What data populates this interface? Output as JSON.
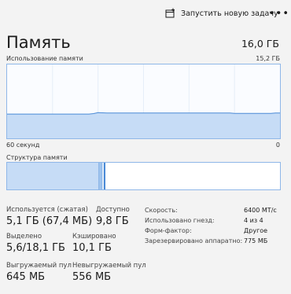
{
  "toolbar": {
    "run_task_label": "Запустить новую задачу",
    "more_label": "•••"
  },
  "header": {
    "title": "Память",
    "total": "16,0 ГБ"
  },
  "usage_chart": {
    "label": "Использование памяти",
    "max_label": "15,2 ГБ",
    "time_label": "60 секунд",
    "zero_label": "0"
  },
  "structure": {
    "label": "Структура памяти"
  },
  "stats": {
    "in_use": {
      "label": "Используется (сжатая)",
      "value": "5,1 ГБ (67,4 МБ)"
    },
    "available": {
      "label": "Доступно",
      "value": "9,8 ГБ"
    },
    "committed": {
      "label": "Выделено",
      "value": "5,6/18,1 ГБ"
    },
    "cached": {
      "label": "Кэшировано",
      "value": "10,1 ГБ"
    },
    "paged_pool": {
      "label": "Выгружаемый пул",
      "value": "645 МБ"
    },
    "nonpaged_pool": {
      "label": "Невыгружаемый пул",
      "value": "556 МБ"
    }
  },
  "properties": [
    {
      "key": "Скорость:",
      "value": "6400 МТ/с"
    },
    {
      "key": "Использовано гнезд:",
      "value": "4 из 4"
    },
    {
      "key": "Форм-фактор:",
      "value": "Другое"
    },
    {
      "key": "Зарезервировано аппаратно:",
      "value": "775 МБ"
    }
  ],
  "chart_data": {
    "type": "area",
    "title": "Использование памяти",
    "ylim": [
      0,
      15.2
    ],
    "y_unit": "ГБ",
    "x_range_label": "60 секунд",
    "values": [
      5.0,
      5.0,
      5.0,
      5.0,
      5.0,
      5.0,
      5.0,
      5.0,
      5.0,
      5.0,
      5.0,
      5.0,
      5.0,
      5.0,
      5.0,
      5.0,
      5.0,
      5.0,
      5.0,
      5.1,
      5.3,
      5.25,
      5.2,
      5.2,
      5.2,
      5.2,
      5.2,
      5.2,
      5.2,
      5.2,
      5.2,
      5.2,
      5.2,
      5.2,
      5.2,
      5.2,
      5.2,
      5.2,
      5.2,
      5.2,
      5.2,
      5.2,
      5.2,
      5.2,
      5.2,
      5.2,
      5.2,
      5.2,
      5.2,
      5.2,
      5.15,
      5.15,
      5.15,
      5.15,
      5.15,
      5.15,
      5.15,
      5.15,
      5.15,
      5.2,
      5.2
    ],
    "colors": {
      "fill": "#c6dcf6",
      "line": "#4a8ad6"
    }
  }
}
